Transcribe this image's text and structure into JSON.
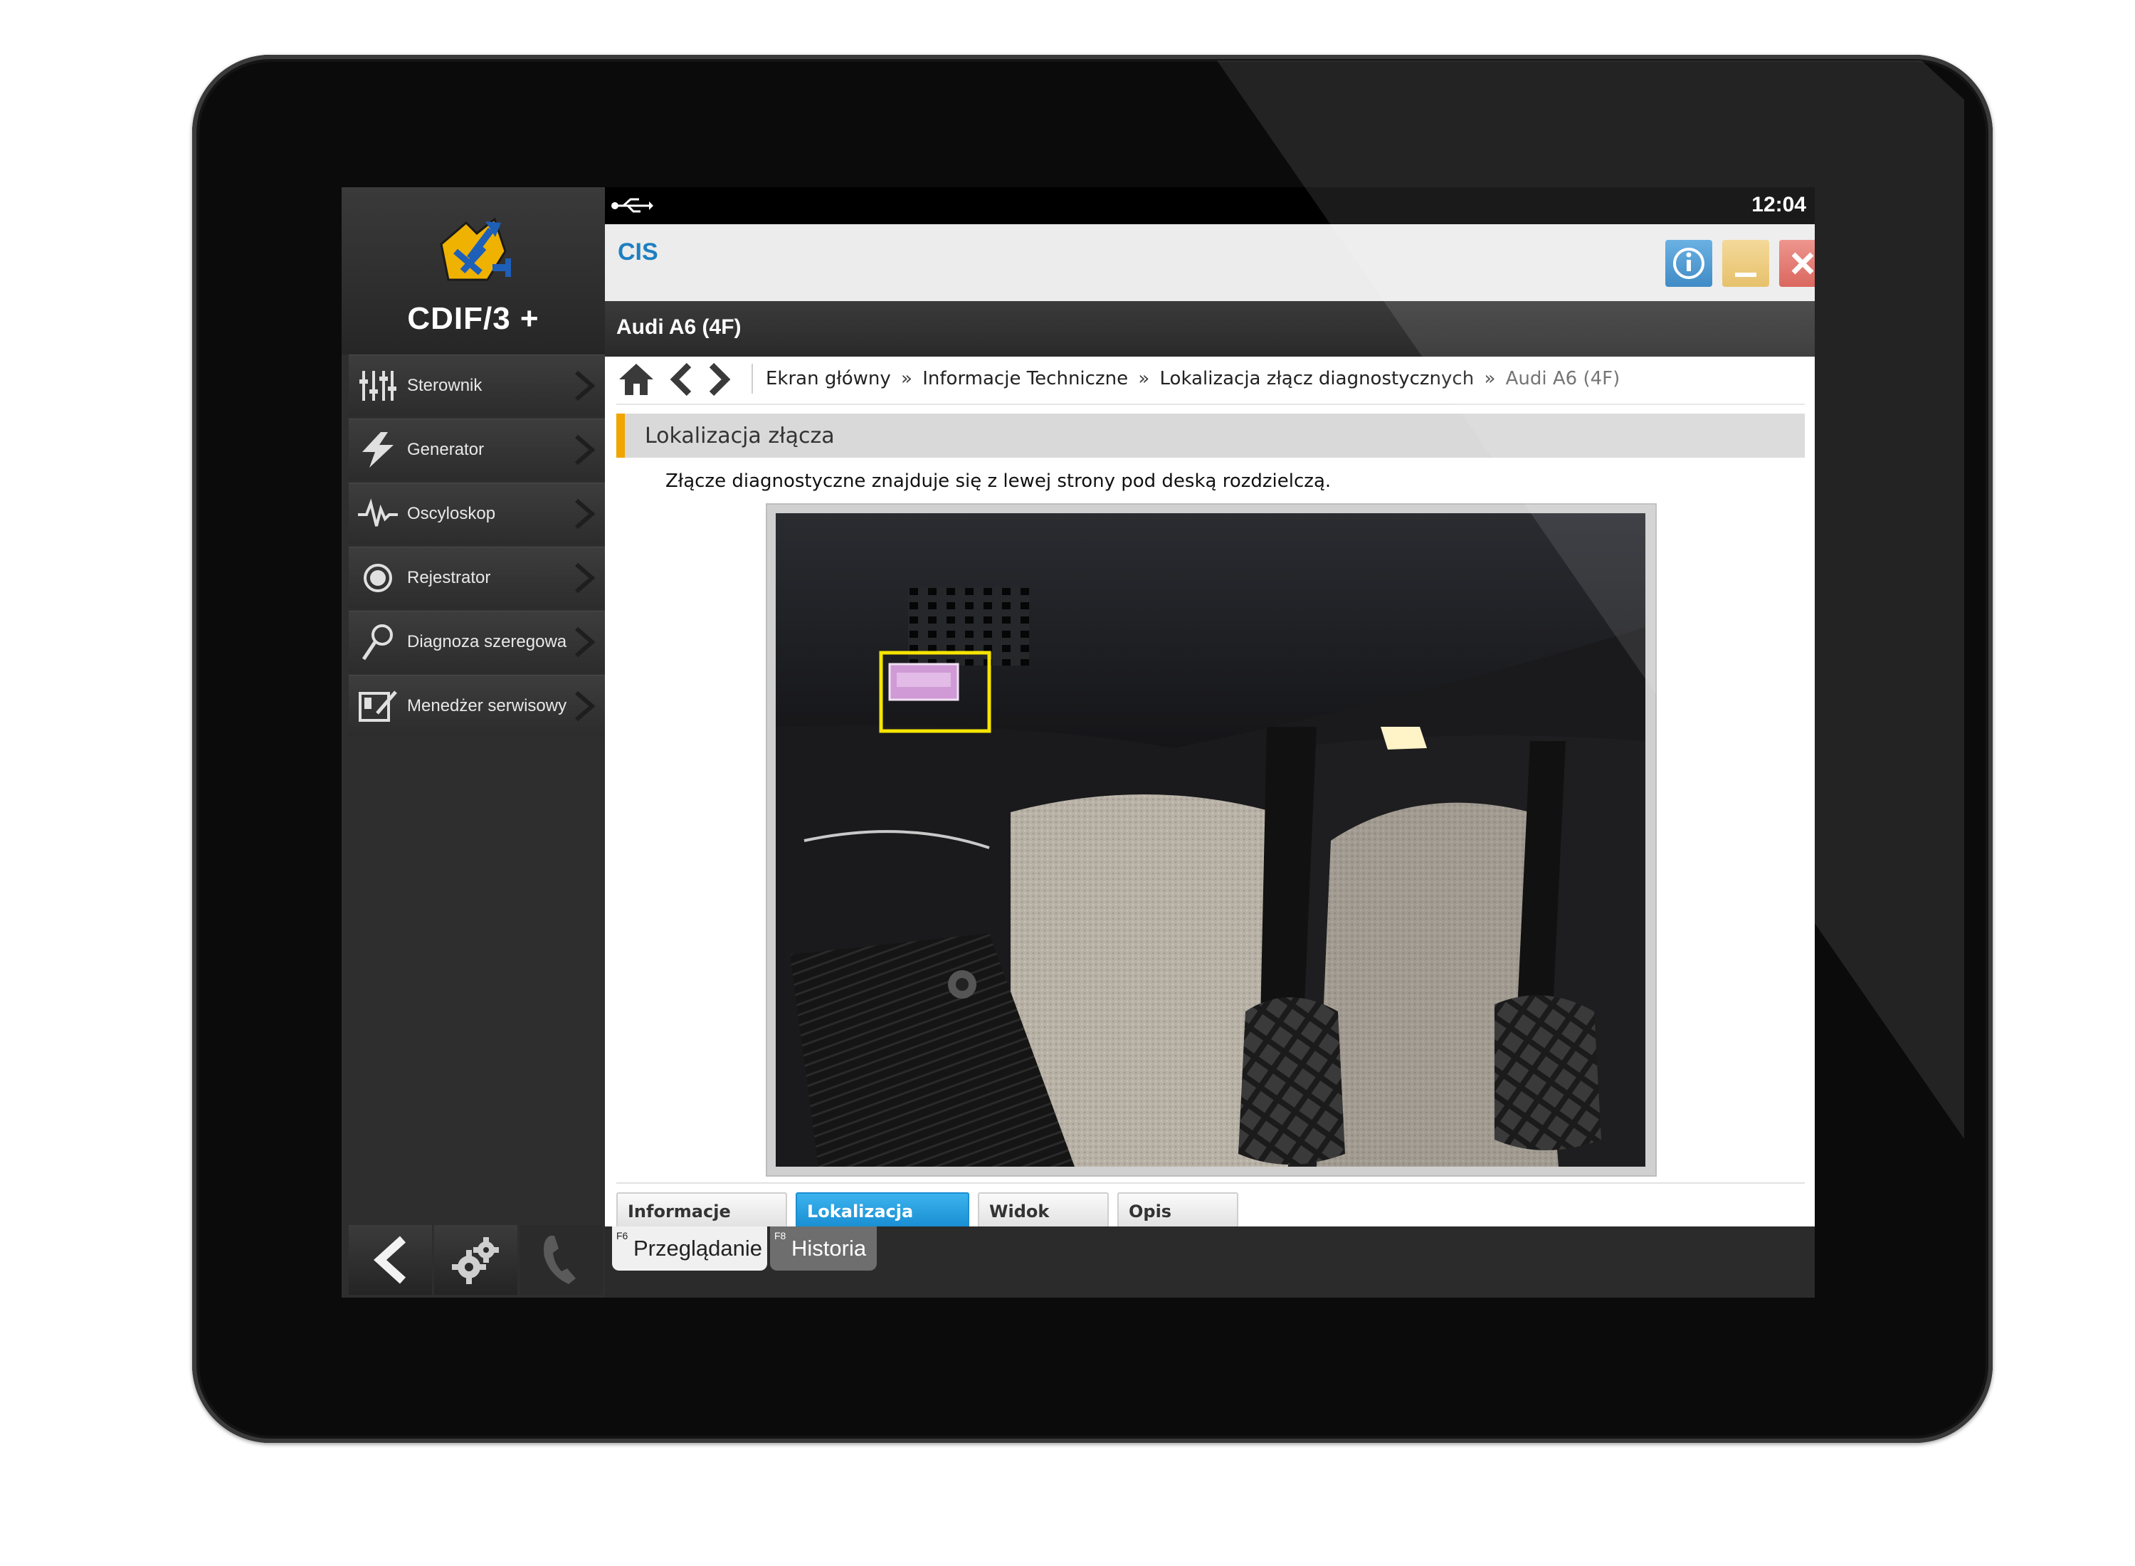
{
  "sidebar": {
    "logo_text": "CDIF/3 +",
    "items": [
      {
        "label": "Sterownik",
        "icon": "sliders-icon"
      },
      {
        "label": "Generator",
        "icon": "lightning-icon"
      },
      {
        "label": "Oscyloskop",
        "icon": "waveform-icon"
      },
      {
        "label": "Rejestrator",
        "icon": "record-icon"
      },
      {
        "label": "Diagnoza szeregowa",
        "icon": "magnifier-icon"
      },
      {
        "label": "Menedżer serwisowy",
        "icon": "notebook-icon"
      }
    ],
    "bottom": [
      "back-icon",
      "settings-icon",
      "phone-icon"
    ]
  },
  "statusbar": {
    "time": "12:04"
  },
  "window": {
    "title": "CIS"
  },
  "vehicle": {
    "title": "Audi A6 (4F)"
  },
  "breadcrumb": {
    "items": [
      "Ekran główny",
      "Informacje Techniczne",
      "Lokalizacja złącz diagnostycznych",
      "Audi A6 (4F)"
    ],
    "separator": "»"
  },
  "section": {
    "title": "Lokalizacja złącza",
    "description": "Złącze diagnostyczne znajduje się z lewej strony pod deską rozdzielczą."
  },
  "tabs": [
    {
      "label": "Informacje ogólne",
      "active": false
    },
    {
      "label": "Lokalizacja złącza",
      "active": true
    },
    {
      "label": "Widok złącza",
      "active": false
    },
    {
      "label": "Opis złącza",
      "active": false
    }
  ],
  "footer_tabs": [
    {
      "key": "F6",
      "label": "Przeglądanie",
      "active": true
    },
    {
      "key": "F8",
      "label": "Historia",
      "active": false
    }
  ],
  "colors": {
    "accent_blue": "#1d7fc1",
    "active_tab": "#1a8fd3",
    "section_marker": "#f0a500",
    "highlight_box": "#f5e400"
  }
}
